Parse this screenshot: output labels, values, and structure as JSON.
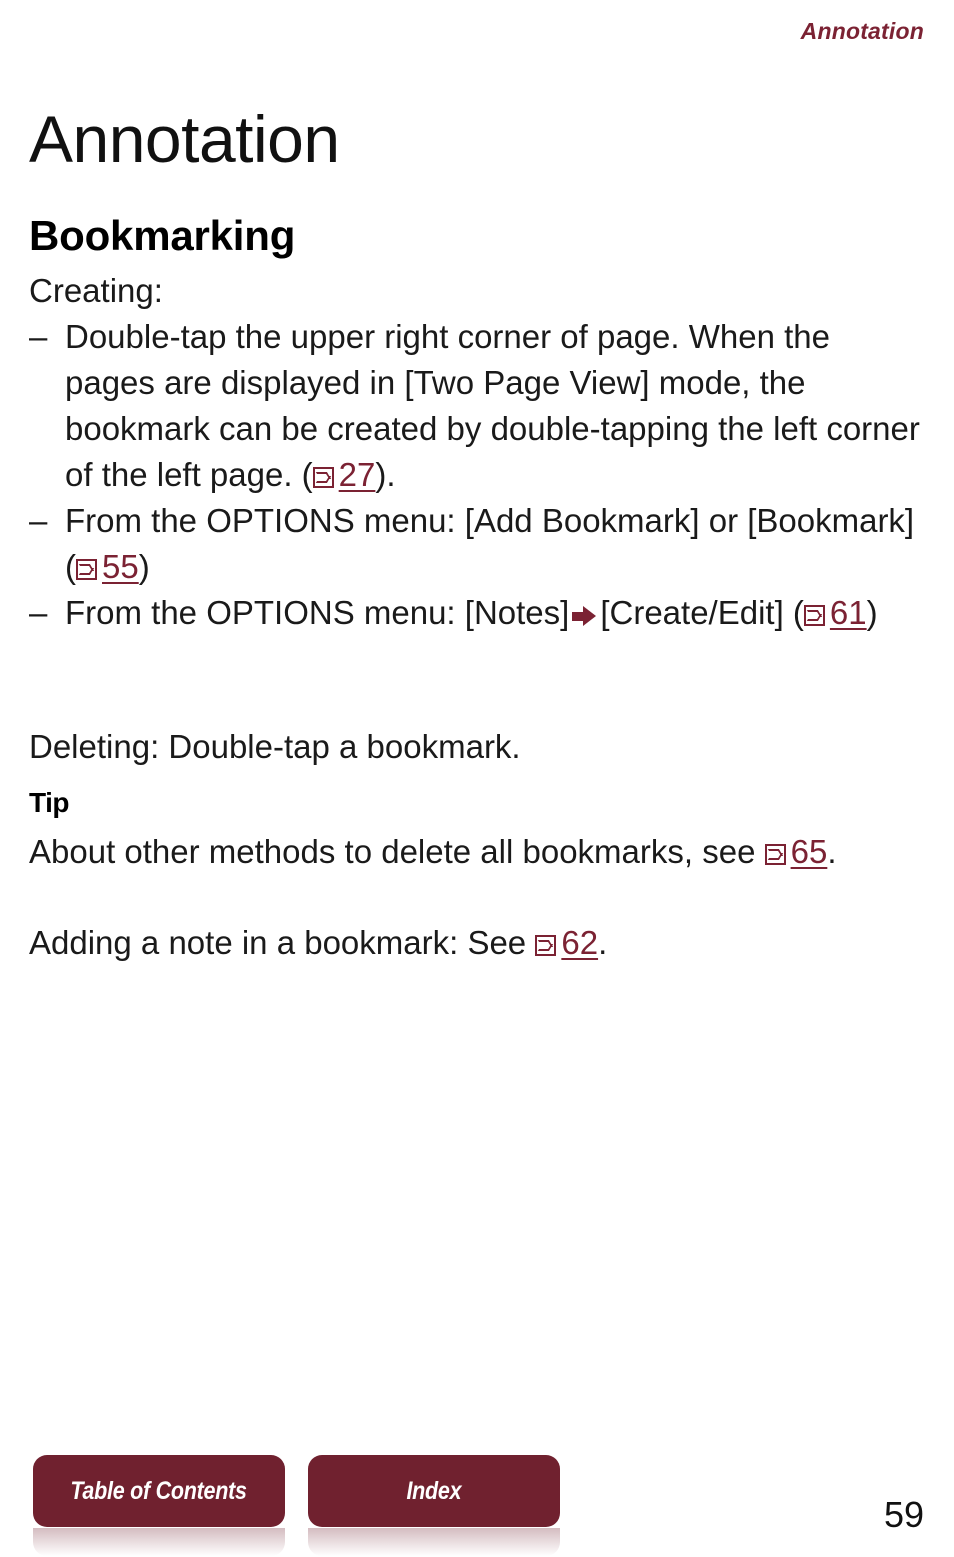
{
  "header": {
    "running_title": "Annotation"
  },
  "chapter": {
    "title": "Annotation"
  },
  "section": {
    "title": "Bookmarking"
  },
  "content": {
    "creating_label": "Creating:",
    "bullet_dash": "–",
    "bullets": [
      {
        "text_before": "Double-tap the upper right corner of page. When the pages are displayed in [Two Page View] mode, the bookmark can be created by double-tapping the left corner of the left page. (",
        "ref_icon": "page-reference-icon",
        "ref_page": "27",
        "text_after": ")."
      },
      {
        "text_before": "From the OPTIONS menu: [Add Bookmark] or [Bookmark] (",
        "ref_icon": "page-reference-icon",
        "ref_page": "55",
        "text_after": ")"
      },
      {
        "text_before_a": "From the OPTIONS menu: [Notes]",
        "arrow_icon": "right-arrow-icon",
        "text_before_b": "[Create/Edit] (",
        "ref_icon": "page-reference-icon",
        "ref_page": "61",
        "text_after": ")"
      }
    ],
    "deleting_line": "Deleting: Double-tap a bookmark.",
    "tip_label": "Tip",
    "tip_text_before": "About other methods to delete all bookmarks, see",
    "tip_ref_page": "65",
    "tip_text_after": ".",
    "note_text_before": "Adding a note in a bookmark: See",
    "note_ref_page": "62",
    "note_text_after": "."
  },
  "nav": {
    "toc_label": "Table of Contents",
    "index_label": "Index"
  },
  "footer": {
    "page_number": "59"
  },
  "colors": {
    "accent_maroon": "#70212f",
    "link_red": "#7b2233",
    "text_black": "#1a1a1a",
    "background": "#ffffff"
  }
}
